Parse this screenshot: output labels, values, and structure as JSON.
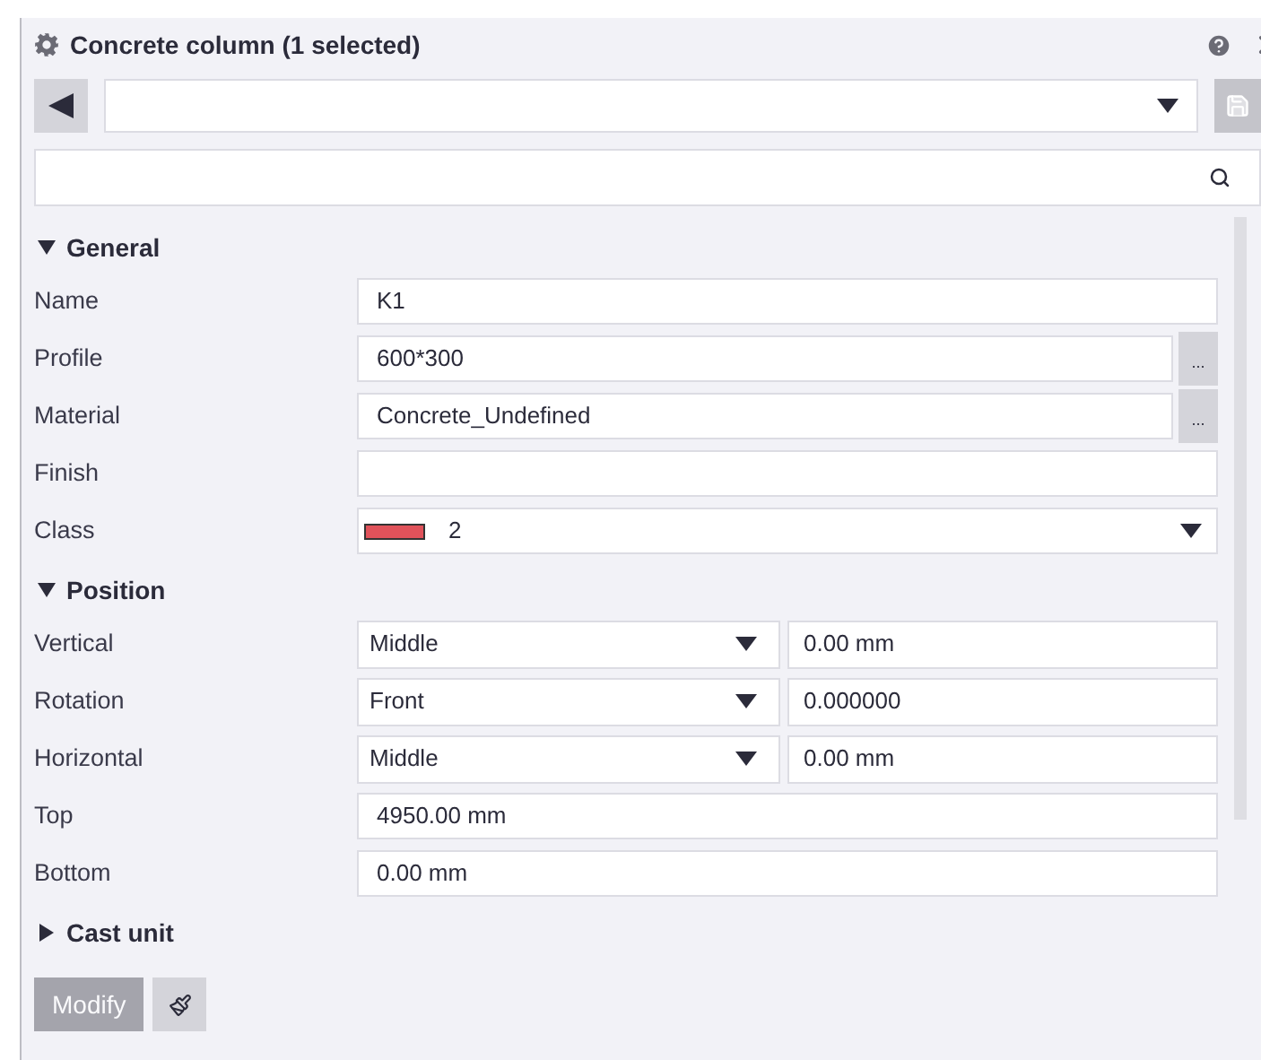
{
  "title": "Concrete column (1 selected)",
  "sections": [
    {
      "label": "General",
      "expanded": true,
      "rows": [
        {
          "label": "Name",
          "kind": "text",
          "value": "K1"
        },
        {
          "label": "Profile",
          "kind": "browse",
          "value": "600*300",
          "button": "..."
        },
        {
          "label": "Material",
          "kind": "browse",
          "value": "Concrete_Undefined",
          "button": "..."
        },
        {
          "label": "Finish",
          "kind": "text",
          "value": ""
        },
        {
          "label": "Class",
          "kind": "color",
          "value": "2",
          "color": "#e0525a"
        }
      ]
    },
    {
      "label": "Position",
      "expanded": true,
      "rows": [
        {
          "label": "Vertical",
          "kind": "pair",
          "value": "Middle",
          "value_2": "0.00 mm"
        },
        {
          "label": "Rotation",
          "kind": "pair",
          "value": "Front",
          "value_2": "0.000000"
        },
        {
          "label": "Horizontal",
          "kind": "pair",
          "value": "Middle",
          "value_2": "0.00 mm"
        },
        {
          "label": "Top",
          "kind": "text",
          "value": "4950.00 mm"
        },
        {
          "label": "Bottom",
          "kind": "text",
          "value": "0.00 mm"
        }
      ]
    },
    {
      "label": "Cast unit",
      "expanded": false
    }
  ],
  "modify": {
    "label": "Modify",
    "disabled": true
  }
}
